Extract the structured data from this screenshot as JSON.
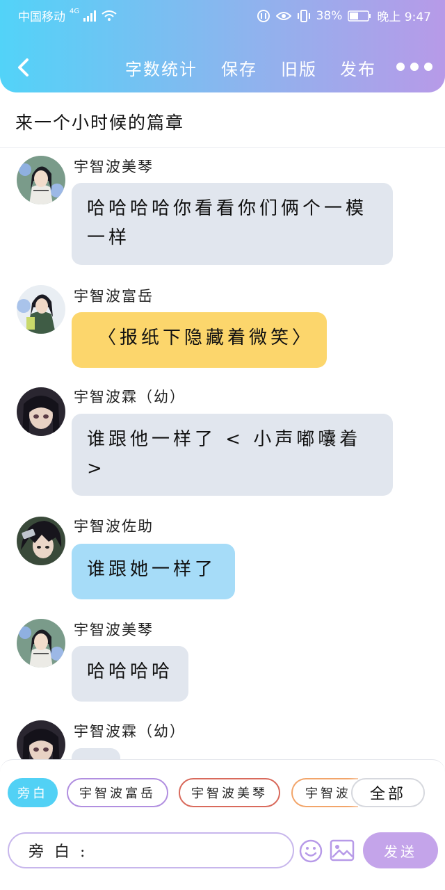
{
  "status_bar": {
    "carrier": "中国移动",
    "network": "4G",
    "battery": "38%",
    "time": "晚上 9:47"
  },
  "toolbar": {
    "word_count": "字数统计",
    "save": "保存",
    "old_version": "旧版",
    "publish": "发布"
  },
  "chapter_title": "来一个小时候的篇章",
  "messages": [
    {
      "name": "宇智波美琴",
      "text": "哈哈哈哈你看看你们俩个一模一样",
      "bubble": "gray"
    },
    {
      "name": "宇智波富岳",
      "text": "〈报纸下隐藏着微笑〉",
      "bubble": "yellow"
    },
    {
      "name": "宇智波霖（幼）",
      "text": "谁跟他一样了 < 小声嘟囔着 >",
      "bubble": "gray"
    },
    {
      "name": "宇智波佐助",
      "text": "谁跟她一样了",
      "bubble": "blue"
    },
    {
      "name": "宇智波美琴",
      "text": "哈哈哈哈",
      "bubble": "gray"
    },
    {
      "name": "宇智波霖（幼）",
      "text": "",
      "bubble": "gray"
    }
  ],
  "role_chips": {
    "narrator": "旁白",
    "roles": [
      "宇智波富岳",
      "宇智波美琴",
      "宇智波"
    ],
    "all": "全部"
  },
  "input": {
    "value": "旁 白 :",
    "send_label": "发送"
  },
  "colors": {
    "header_gradient_start": "#52d3f8",
    "header_gradient_end": "#b79ae8",
    "bubble_gray": "#e1e6ee",
    "bubble_yellow": "#fcd66c",
    "bubble_blue": "#a6dcf8",
    "send_button": "#c4a4ea"
  },
  "icons": [
    "back-icon",
    "more-icon",
    "emoji-icon",
    "image-icon",
    "signal-icon",
    "wifi-icon",
    "battery-icon"
  ]
}
